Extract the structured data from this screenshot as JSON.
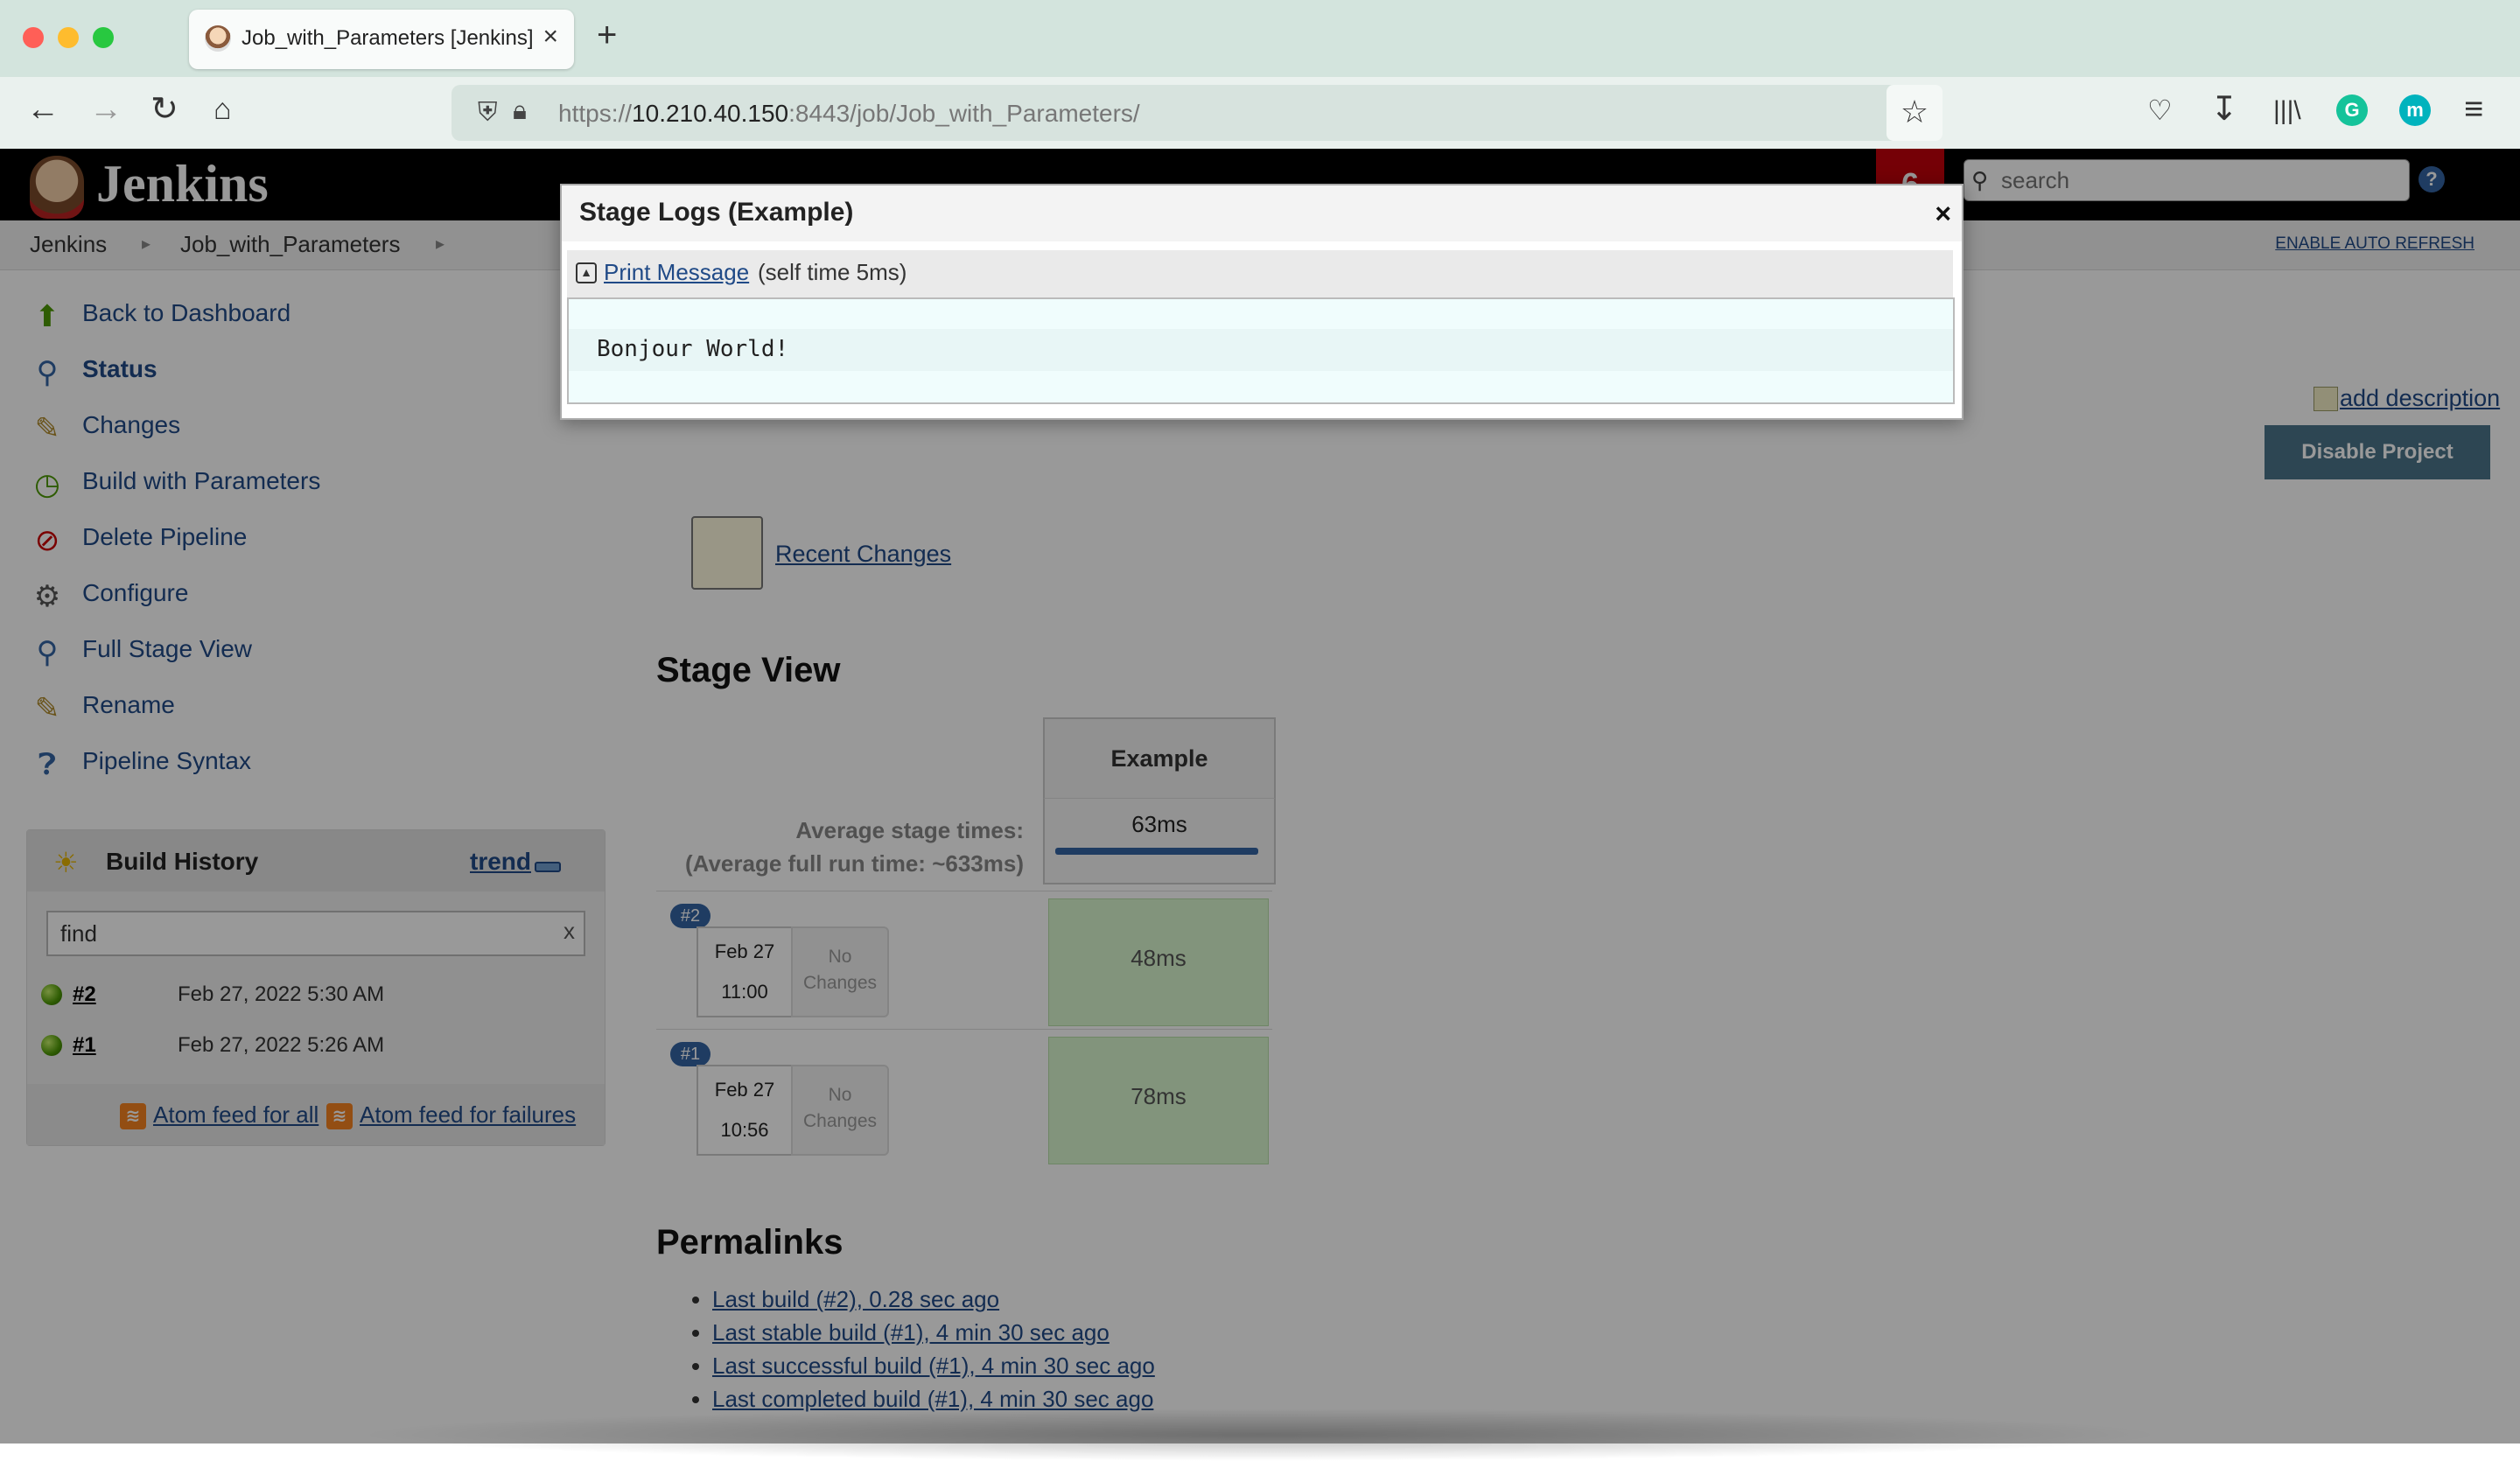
{
  "browser": {
    "tab_title": "Job_with_Parameters [Jenkins]",
    "tab_close": "×",
    "new_tab": "+",
    "url_scheme": "https://",
    "url_host": "10.210.40.150",
    "url_rest": ":8443/job/Job_with_Parameters/",
    "profile_initial": "m",
    "colors": {
      "close": "#ff5f57",
      "minimize": "#febc2e",
      "zoom": "#28c840",
      "grammarly": "#15c39a",
      "profile": "#00b3bd"
    }
  },
  "jenkins": {
    "logo_text": "Jenkins",
    "notification_count": "6",
    "search_placeholder": "search",
    "help": "?",
    "breadcrumbs": [
      "Jenkins",
      "Job_with_Parameters"
    ],
    "auto_refresh": "ENABLE AUTO REFRESH"
  },
  "sidebar": {
    "items": [
      {
        "label": "Back to Dashboard",
        "icon": "up-arrow-icon"
      },
      {
        "label": "Status",
        "icon": "magnifier-icon"
      },
      {
        "label": "Changes",
        "icon": "notepad-icon"
      },
      {
        "label": "Build with Parameters",
        "icon": "clock-play-icon"
      },
      {
        "label": "Delete Pipeline",
        "icon": "no-entry-icon"
      },
      {
        "label": "Configure",
        "icon": "gear-icon"
      },
      {
        "label": "Full Stage View",
        "icon": "magnifier-icon"
      },
      {
        "label": "Rename",
        "icon": "notepad-icon"
      },
      {
        "label": "Pipeline Syntax",
        "icon": "help-icon"
      }
    ]
  },
  "build_history": {
    "title": "Build History",
    "trend": "trend",
    "filter_value": "find",
    "filter_clear": "x",
    "builds": [
      {
        "number": "#2",
        "date": "Feb 27, 2022 5:30 AM",
        "status": "success"
      },
      {
        "number": "#1",
        "date": "Feb 27, 2022 5:26 AM",
        "status": "success"
      }
    ],
    "feed_all": "Atom feed for all",
    "feed_failures": "Atom feed for failures"
  },
  "main": {
    "add_description": "add description",
    "disable_project": "Disable Project",
    "recent_changes": "Recent Changes",
    "stage_view_title": "Stage View",
    "stage_name": "Example",
    "avg_label_1": "Average stage times:",
    "avg_label_2": "(Average full run time: ~633ms)",
    "avg_time": "63ms",
    "runs": [
      {
        "badge": "#2",
        "date": "Feb 27",
        "time": "11:00",
        "changes_1": "No",
        "changes_2": "Changes",
        "duration": "48ms"
      },
      {
        "badge": "#1",
        "date": "Feb 27",
        "time": "10:56",
        "changes_1": "No",
        "changes_2": "Changes",
        "duration": "78ms"
      }
    ],
    "permalinks_title": "Permalinks",
    "permalinks": [
      "Last build (#2), 0.28 sec ago",
      "Last stable build (#1), 4 min 30 sec ago",
      "Last successful build (#1), 4 min 30 sec ago",
      "Last completed build (#1), 4 min 30 sec ago"
    ]
  },
  "modal": {
    "title": "Stage Logs (Example)",
    "close": "×",
    "node_link": "Print Message",
    "node_time": "(self time 5ms)",
    "log_line": "Bonjour World!"
  }
}
